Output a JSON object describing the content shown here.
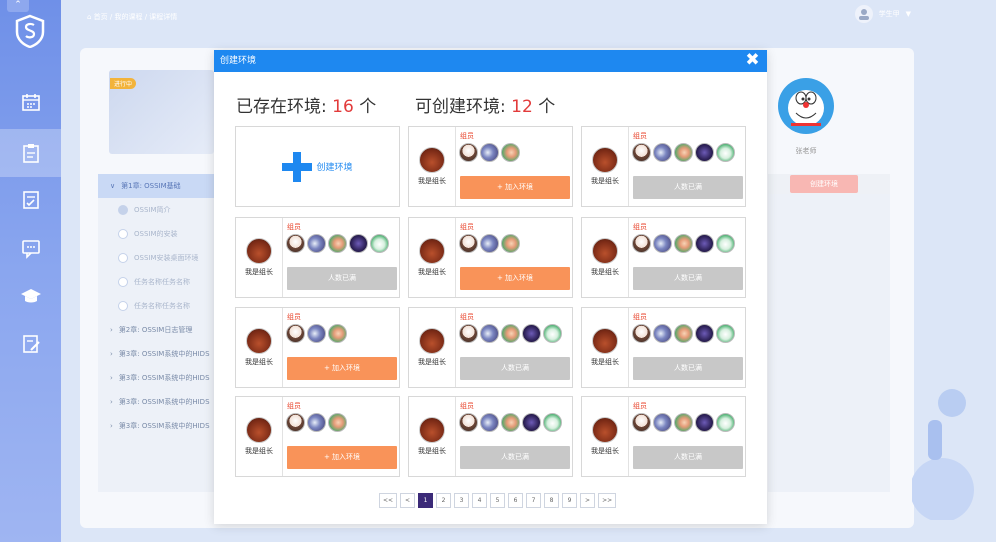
{
  "breadcrumb": "首页 / 我的课程 / 课程详情",
  "user": {
    "name": "学生甲"
  },
  "teacher": {
    "name": "张老师"
  },
  "course": {
    "tag": "进行中"
  },
  "right_button": "创建环境",
  "chapters": [
    {
      "label": "第1章: OSSIM基础",
      "open": true
    },
    {
      "label": "OSSIM简介",
      "sub": true
    },
    {
      "label": "OSSIM的安装",
      "sub": true
    },
    {
      "label": "OSSIM安装桌面环境",
      "sub": true
    },
    {
      "label": "任务名称任务名称",
      "sub": true
    },
    {
      "label": "任务名称任务名称",
      "sub": true
    },
    {
      "label": "第2章: OSSIM日志管理"
    },
    {
      "label": "第3章: OSSIM系统中的HIDS"
    },
    {
      "label": "第3章: OSSIM系统中的HIDS"
    },
    {
      "label": "第3章: OSSIM系统中的HIDS"
    },
    {
      "label": "第3章: OSSIM系统中的HIDS"
    }
  ],
  "modal": {
    "title": "创建环境",
    "existing_label": "已存在环境:",
    "existing_count": "16",
    "existing_unit": "个",
    "creatable_label": "可创建环境:",
    "creatable_count": "12",
    "creatable_unit": "个",
    "create_label": "创建环境",
    "member_label": "组员",
    "leader_label": "我是组长",
    "join_label": "+ 加入环境",
    "full_label": "人数已满"
  },
  "cards": [
    {
      "members": 3,
      "full": false
    },
    {
      "members": 5,
      "full": true
    },
    {
      "members": 5,
      "full": true
    },
    {
      "members": 3,
      "full": false
    },
    {
      "members": 5,
      "full": true
    },
    {
      "members": 3,
      "full": false
    },
    {
      "members": 5,
      "full": true
    },
    {
      "members": 5,
      "full": true
    },
    {
      "members": 3,
      "full": false
    },
    {
      "members": 5,
      "full": true
    },
    {
      "members": 5,
      "full": true
    }
  ],
  "pagination": {
    "pages": [
      "<<",
      "<",
      "1",
      "2",
      "3",
      "4",
      "5",
      "6",
      "7",
      "8",
      "9",
      ">",
      ">>"
    ],
    "current": "1"
  },
  "colors": {
    "accent": "#1e88f0",
    "join": "#f99359",
    "full": "#c8c8c8",
    "count": "#e23b3b"
  }
}
